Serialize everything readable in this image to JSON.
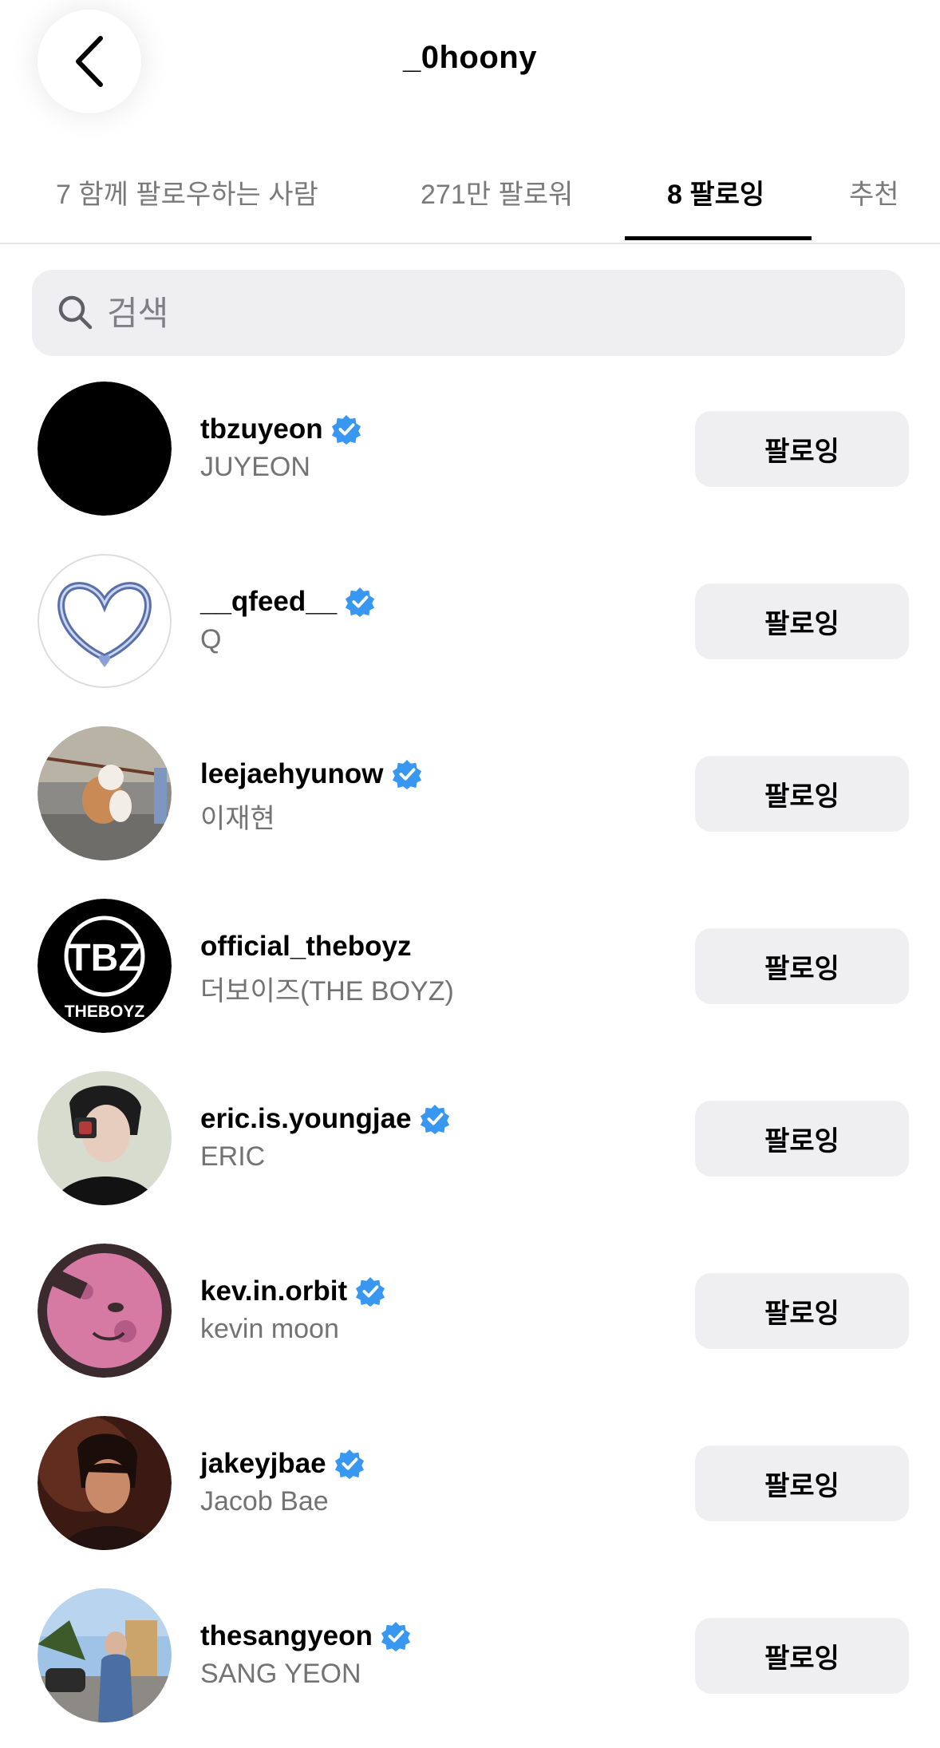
{
  "header": {
    "title": "_0hoony",
    "back_icon": "chevron-left-icon"
  },
  "tabs": [
    {
      "label": "7 함께 팔로우하는 사람",
      "active": false
    },
    {
      "label": "271만 팔로워",
      "active": false
    },
    {
      "label": "8 팔로잉",
      "active": true
    },
    {
      "label": "추천",
      "active": false
    }
  ],
  "search": {
    "placeholder": "검색",
    "value": "",
    "icon": "search-icon"
  },
  "accounts": [
    {
      "username": "tbzuyeon",
      "full_name": "JUYEON",
      "verified": true,
      "button_label": "팔로잉"
    },
    {
      "username": "__qfeed__",
      "full_name": "Q",
      "verified": true,
      "button_label": "팔로잉"
    },
    {
      "username": "leejaehyunow",
      "full_name": "이재현",
      "verified": true,
      "button_label": "팔로잉"
    },
    {
      "username": "official_theboyz",
      "full_name": "더보이즈(THE BOYZ)",
      "verified": false,
      "button_label": "팔로잉",
      "avatar_logo_text": "THEBOYZ"
    },
    {
      "username": "eric.is.youngjae",
      "full_name": "ERIC",
      "verified": true,
      "button_label": "팔로잉"
    },
    {
      "username": "kev.in.orbit",
      "full_name": "kevin moon",
      "verified": true,
      "button_label": "팔로잉"
    },
    {
      "username": "jakeyjbae",
      "full_name": "Jacob Bae",
      "verified": true,
      "button_label": "팔로잉"
    },
    {
      "username": "thesangyeon",
      "full_name": "SANG YEON",
      "verified": true,
      "button_label": "팔로잉"
    }
  ],
  "colors": {
    "verified_badge": "#3897f0",
    "button_bg": "#efeff1",
    "secondary_text": "#737373"
  }
}
